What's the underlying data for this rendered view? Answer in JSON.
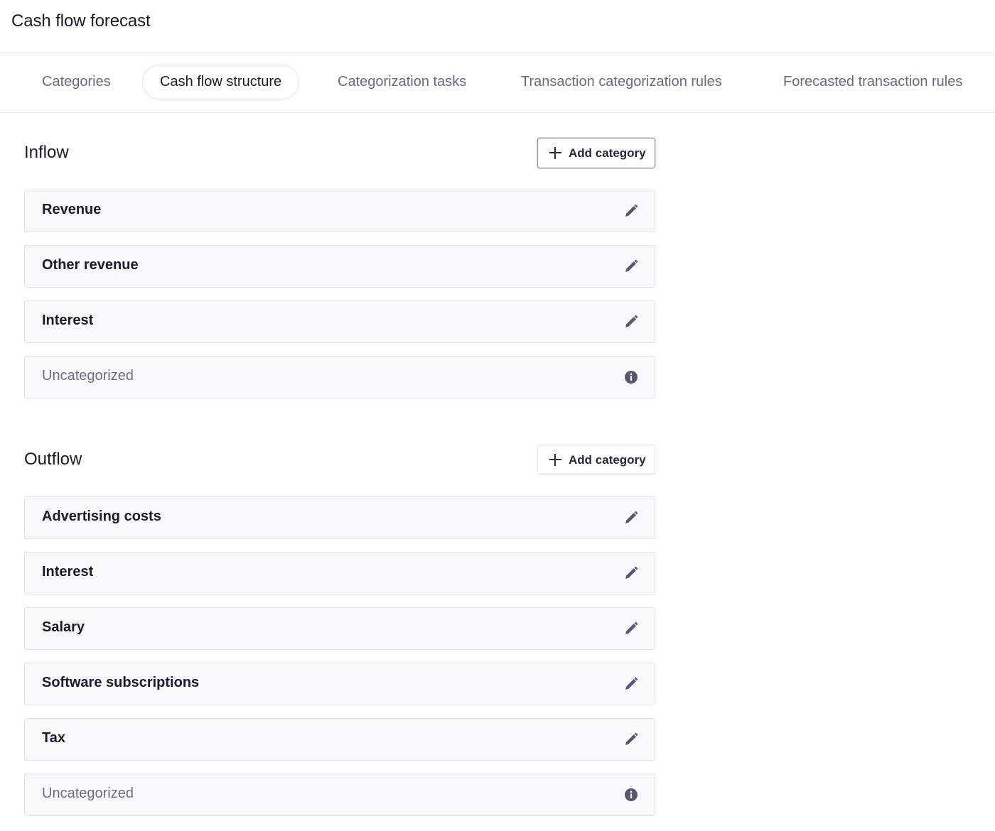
{
  "header": {
    "title": "Cash flow forecast"
  },
  "tabs": [
    {
      "label": "Categories"
    },
    {
      "label": "Cash flow structure",
      "active": true
    },
    {
      "label": "Categorization tasks"
    },
    {
      "label": "Transaction categorization rules"
    },
    {
      "label": "Forecasted transaction rules"
    }
  ],
  "inflow": {
    "title": "Inflow",
    "add_label": "Add category",
    "items": [
      {
        "label": "Revenue",
        "icon": "pencil-icon"
      },
      {
        "label": "Other revenue",
        "icon": "pencil-icon"
      },
      {
        "label": "Interest",
        "icon": "pencil-icon"
      },
      {
        "label": "Uncategorized",
        "icon": "info-icon"
      }
    ]
  },
  "outflow": {
    "title": "Outflow",
    "add_label": "Add category",
    "items": [
      {
        "label": "Advertising costs",
        "icon": "pencil-icon"
      },
      {
        "label": "Interest",
        "icon": "pencil-icon"
      },
      {
        "label": "Salary",
        "icon": "pencil-icon"
      },
      {
        "label": "Software subscriptions",
        "icon": "pencil-icon"
      },
      {
        "label": "Tax",
        "icon": "pencil-icon"
      },
      {
        "label": "Uncategorized",
        "icon": "info-icon"
      }
    ]
  },
  "colors": {
    "accent_focus": "#8e86d6",
    "icon": "#5a5670",
    "muted_text": "#706d82"
  }
}
